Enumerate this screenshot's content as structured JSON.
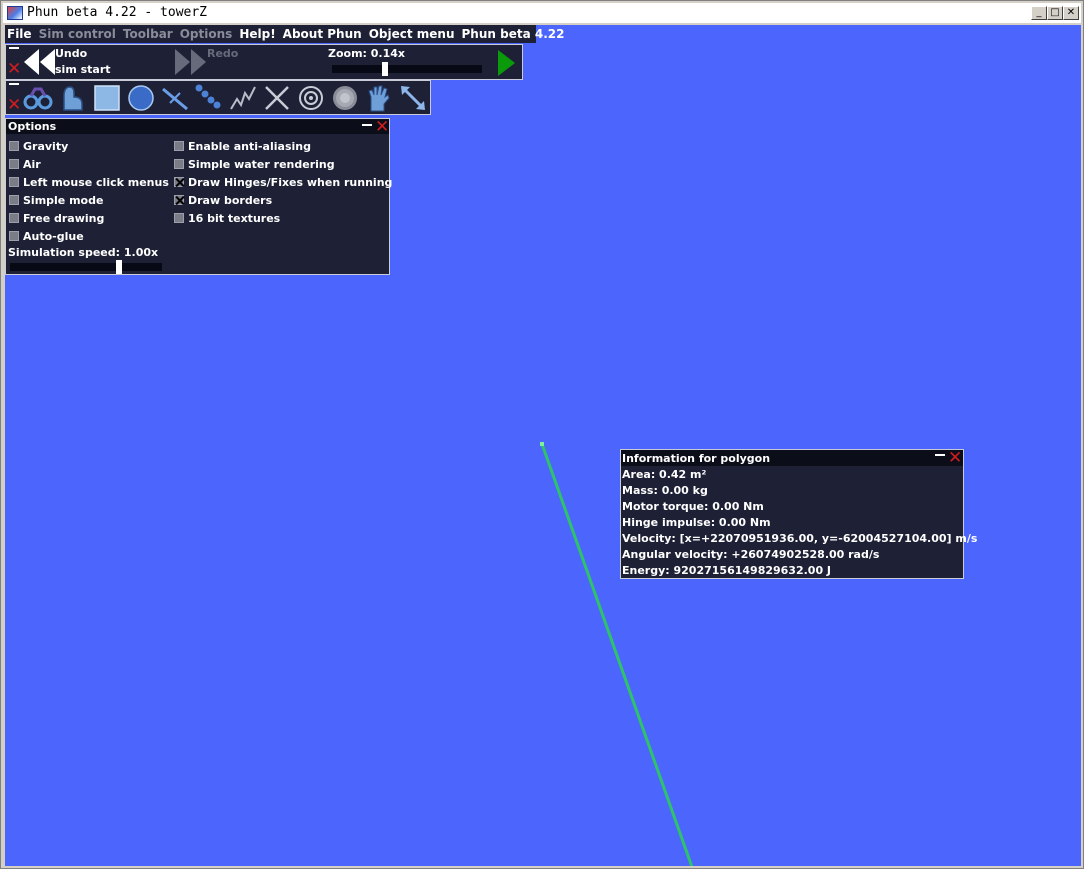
{
  "window": {
    "title": "Phun beta 4.22 - towerZ",
    "minimize": "_",
    "maximize": "□",
    "close": "✕"
  },
  "menu": {
    "items": [
      {
        "label": "File",
        "enabled": true
      },
      {
        "label": "Sim control",
        "enabled": false
      },
      {
        "label": "Toolbar",
        "enabled": false
      },
      {
        "label": "Options",
        "enabled": false
      },
      {
        "label": "Help!",
        "enabled": true
      },
      {
        "label": "About Phun",
        "enabled": true
      },
      {
        "label": "Object menu",
        "enabled": true
      },
      {
        "label": "Phun beta 4.22",
        "enabled": true
      }
    ]
  },
  "sim_control": {
    "undo_line1": "Undo",
    "undo_line2": "sim start",
    "redo": "Redo",
    "zoom_label": "Zoom: 0.14x",
    "zoom_slider_fraction": 0.35
  },
  "toolbar": {
    "tools": [
      "drag-tool",
      "move-tool",
      "box-tool",
      "circle-tool",
      "plane-tool",
      "chain-tool",
      "spring-tool",
      "fixate-tool",
      "hinge-tool",
      "brush-tool",
      "grab-tool",
      "scale-tool"
    ]
  },
  "options": {
    "title": "Options",
    "left": [
      {
        "label": "Gravity",
        "checked": false
      },
      {
        "label": "Air",
        "checked": false
      },
      {
        "label": "Left mouse click menus",
        "checked": false
      },
      {
        "label": "Simple mode",
        "checked": false
      },
      {
        "label": "Free drawing",
        "checked": false
      },
      {
        "label": "Auto-glue",
        "checked": false
      }
    ],
    "right": [
      {
        "label": "Enable anti-aliasing",
        "checked": false
      },
      {
        "label": "Simple water rendering",
        "checked": false
      },
      {
        "label": "Draw Hinges/Fixes when running",
        "checked": true
      },
      {
        "label": "Draw borders",
        "checked": true
      },
      {
        "label": "16 bit textures",
        "checked": false
      }
    ],
    "speed_label": "Simulation speed: 1.00x",
    "speed_slider_fraction": 0.72
  },
  "info": {
    "title": "Information for polygon",
    "rows": [
      "Area: 0.42 m²",
      "Mass: 0.00 kg",
      "Motor torque: 0.00 Nm",
      "Hinge impulse: 0.00 Nm",
      "Velocity: [x=+22070951936.00, y=-62004527104.00] m/s",
      "Angular velocity: +26074902528.00 rad/s",
      "Energy: 92027156149829632.00 J"
    ]
  },
  "colors": {
    "canvas": "#4b65fd",
    "panel": "#1e2136",
    "line": "#2ec36a",
    "close": "#d11d1d",
    "play": "#0a9a0a"
  }
}
